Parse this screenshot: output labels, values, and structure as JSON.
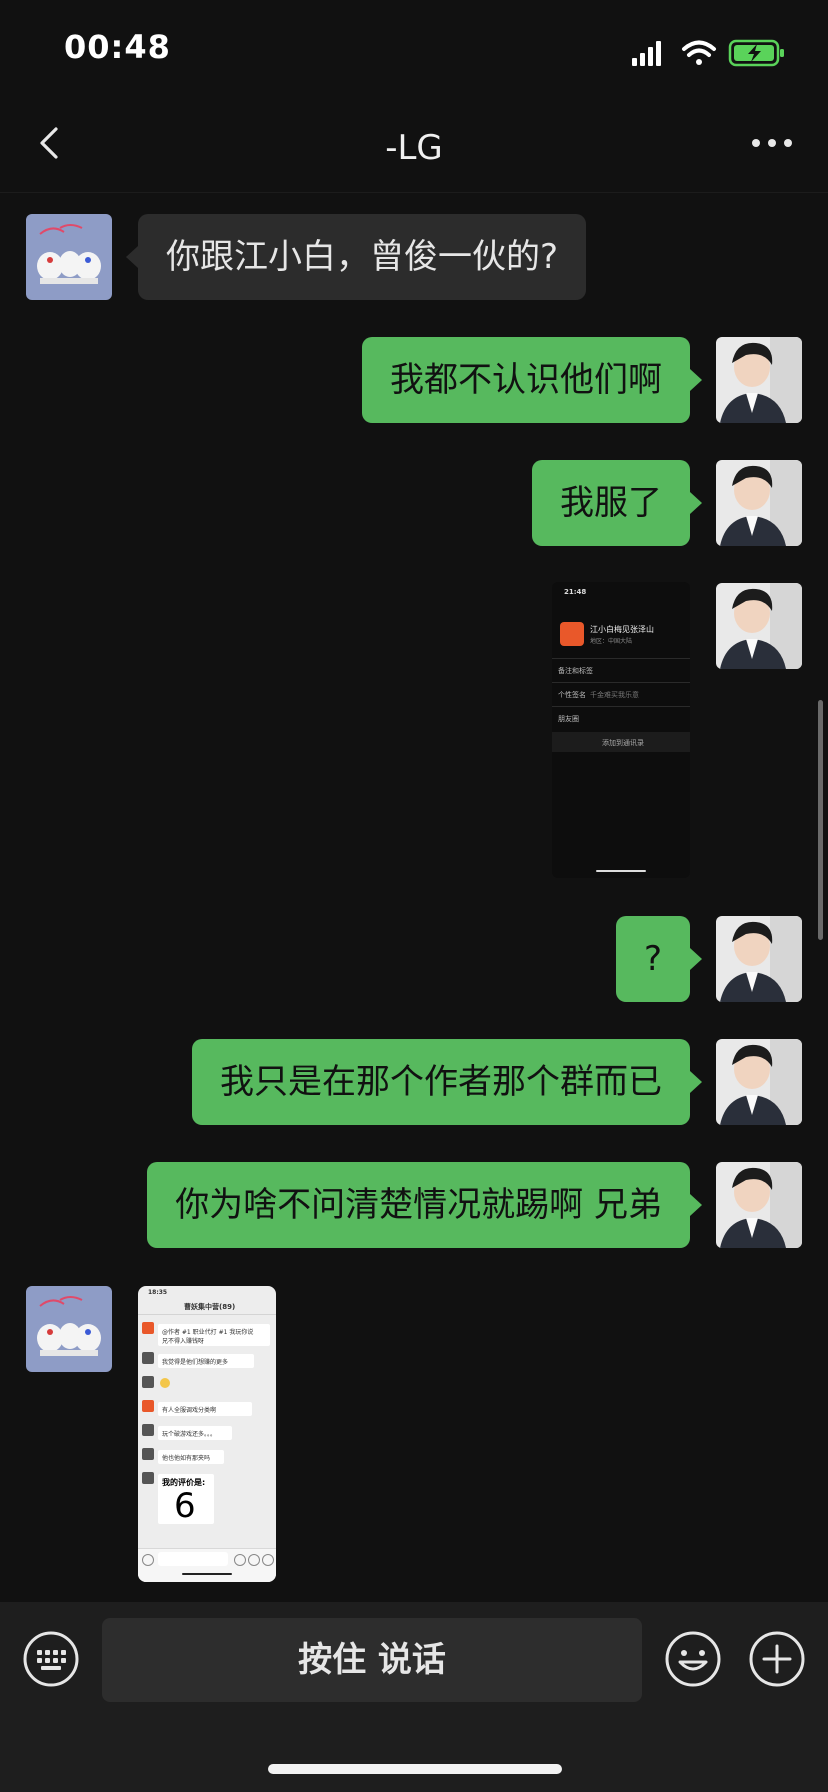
{
  "status_bar": {
    "time": "00:48",
    "icons": [
      "cellular-signal-icon",
      "wifi-icon",
      "battery-charging-icon"
    ],
    "battery_color": "#5ad35a"
  },
  "nav": {
    "back_icon": "chevron-left-icon",
    "title": "-LG",
    "more_icon": "more-dots-icon"
  },
  "messages": [
    {
      "side": "in",
      "type": "text",
      "text": "你跟江小白，曾俊一伙的?"
    },
    {
      "side": "out",
      "type": "text",
      "text": "我都不认识他们啊"
    },
    {
      "side": "out",
      "type": "text",
      "text": "我服了"
    },
    {
      "side": "out",
      "type": "image",
      "image": {
        "time": "21:48",
        "name": "江小白梅见张泽山",
        "region": "地区：中国大陆",
        "rows": [
          "备注和标签",
          "个性签名",
          "朋友圈"
        ],
        "signature": "千金难买我乐意",
        "button": "添加到通讯录"
      }
    },
    {
      "side": "out",
      "type": "text",
      "text": "?"
    },
    {
      "side": "out",
      "type": "text",
      "text": "我只是在那个作者那个群而已"
    },
    {
      "side": "out",
      "type": "text",
      "text": "你为啥不问清楚情况就踢啊 兄弟"
    },
    {
      "side": "in",
      "type": "image",
      "image": {
        "time": "18:35",
        "group": "曹妖集中营(89)",
        "lines": [
          "@作者 #1 职业代打 #1 我玩你说",
          "兄不得入赚钱呀",
          "我觉得是他们想赚的更多",
          "有人全服调戏分类啊",
          "玩个破游戏还多。。。",
          "他也他如有那夹吗"
        ],
        "rating_label": "我的评价是:",
        "rating_value": "6"
      }
    }
  ],
  "input_bar": {
    "keyboard_icon": "keyboard-icon",
    "hold_to_talk": "按住 说话",
    "emoji_icon": "emoji-icon",
    "plus_icon": "plus-icon"
  },
  "colors": {
    "background": "#111111",
    "outgoing_bubble": "#57b95e",
    "incoming_bubble": "#2c2c2c",
    "input_bar": "#1e1e1e"
  }
}
